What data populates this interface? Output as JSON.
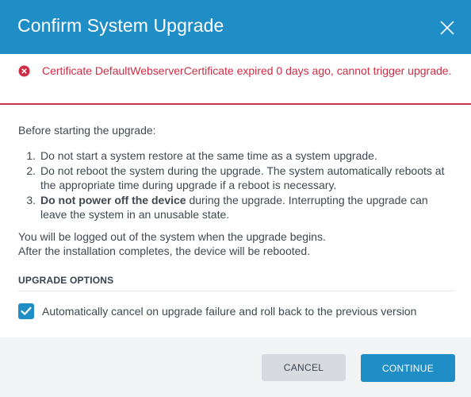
{
  "dialog": {
    "title": "Confirm System Upgrade",
    "close_icon": "close-icon"
  },
  "error": {
    "icon": "error-circle-icon",
    "message": "Certificate DefaultWebserverCertificate expired 0 days ago, cannot trigger upgrade."
  },
  "body": {
    "intro": "Before starting the upgrade:",
    "steps": [
      {
        "num": "1.",
        "bold": "",
        "text": "Do not start a system restore at the same time as a system upgrade."
      },
      {
        "num": "2.",
        "bold": "",
        "text": "Do not reboot the system during the upgrade. The system automatically reboots at the appropriate time during upgrade if a reboot is necessary."
      },
      {
        "num": "3.",
        "bold": "Do not power off the device",
        "text": " during the upgrade. Interrupting the upgrade can leave the system in an unusable state."
      }
    ],
    "note_line1": "You will be logged out of the system when the upgrade begins.",
    "note_line2": "After the installation completes, the device will be rebooted."
  },
  "options": {
    "section_title": "UPGRADE OPTIONS",
    "auto_cancel_label": "Automatically cancel on upgrade failure and roll back to the previous version",
    "auto_cancel_checked": true
  },
  "footer": {
    "cancel_label": "CANCEL",
    "continue_label": "CONTINUE"
  },
  "colors": {
    "header": "#1f8dc6",
    "error": "#d02c44",
    "accent": "#1f8dc6"
  }
}
